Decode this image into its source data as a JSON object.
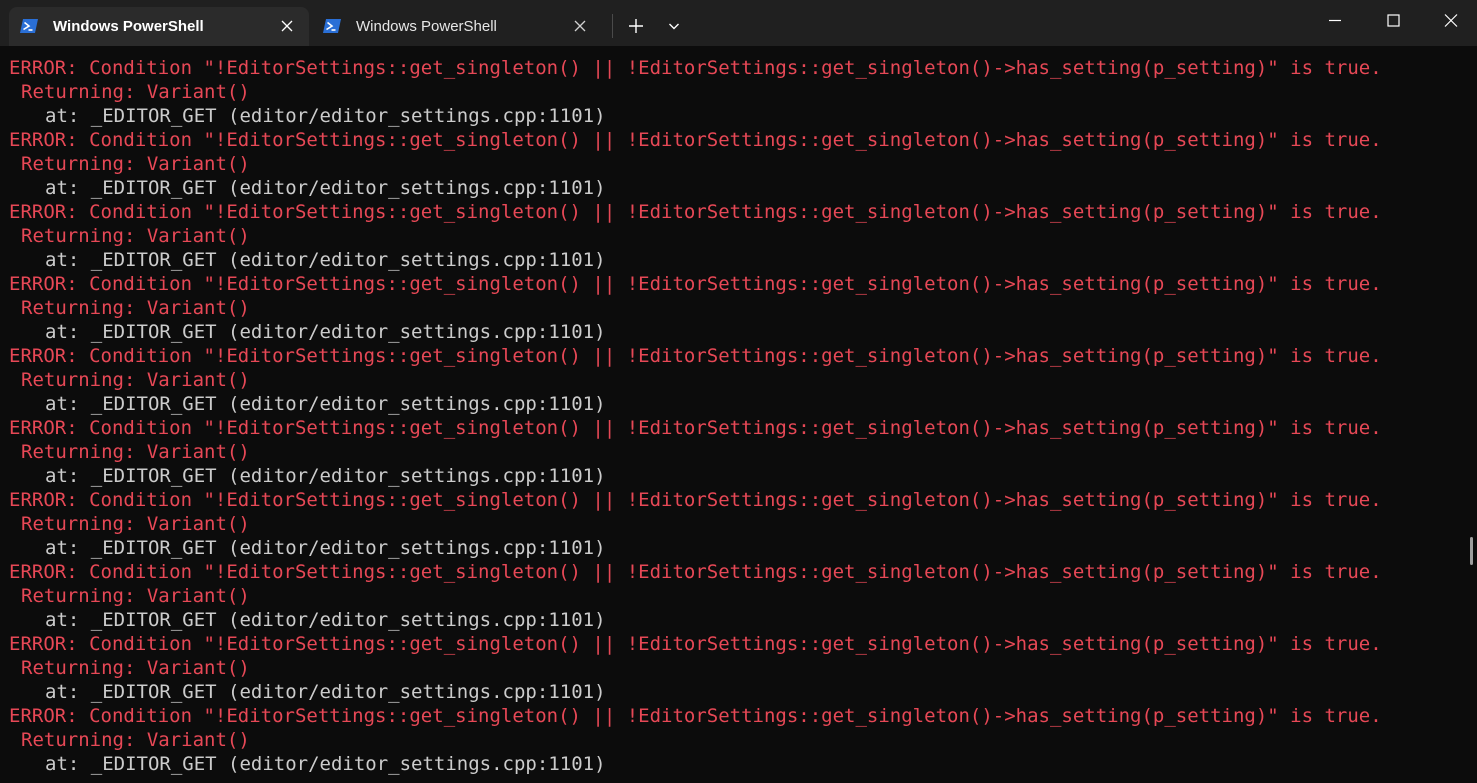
{
  "tabs": [
    {
      "title": "Windows PowerShell",
      "active": true,
      "icon": "powershell-icon"
    },
    {
      "title": "Windows PowerShell",
      "active": false,
      "icon": "powershell-icon"
    }
  ],
  "colors": {
    "background": "#0c0c0c",
    "titlebar": "#202020",
    "active_tab": "#2b2b2b",
    "error_red": "#e74856",
    "normal_text": "#cccccc",
    "ps_icon_blue": "#2a6fd6"
  },
  "terminal": {
    "entries": [
      {
        "prefix": "ERROR:",
        "message": " Condition \"!EditorSettings::get_singleton() || !EditorSettings::get_singleton()->has_setting(p_setting)\" is true.",
        "returning": "Returning: Variant()",
        "at": "at: _EDITOR_GET (editor/editor_settings.cpp:1101)"
      },
      {
        "prefix": "ERROR:",
        "message": " Condition \"!EditorSettings::get_singleton() || !EditorSettings::get_singleton()->has_setting(p_setting)\" is true.",
        "returning": "Returning: Variant()",
        "at": "at: _EDITOR_GET (editor/editor_settings.cpp:1101)"
      },
      {
        "prefix": "ERROR:",
        "message": " Condition \"!EditorSettings::get_singleton() || !EditorSettings::get_singleton()->has_setting(p_setting)\" is true.",
        "returning": "Returning: Variant()",
        "at": "at: _EDITOR_GET (editor/editor_settings.cpp:1101)"
      },
      {
        "prefix": "ERROR:",
        "message": " Condition \"!EditorSettings::get_singleton() || !EditorSettings::get_singleton()->has_setting(p_setting)\" is true.",
        "returning": "Returning: Variant()",
        "at": "at: _EDITOR_GET (editor/editor_settings.cpp:1101)"
      },
      {
        "prefix": "ERROR:",
        "message": " Condition \"!EditorSettings::get_singleton() || !EditorSettings::get_singleton()->has_setting(p_setting)\" is true.",
        "returning": "Returning: Variant()",
        "at": "at: _EDITOR_GET (editor/editor_settings.cpp:1101)"
      },
      {
        "prefix": "ERROR:",
        "message": " Condition \"!EditorSettings::get_singleton() || !EditorSettings::get_singleton()->has_setting(p_setting)\" is true.",
        "returning": "Returning: Variant()",
        "at": "at: _EDITOR_GET (editor/editor_settings.cpp:1101)"
      },
      {
        "prefix": "ERROR:",
        "message": " Condition \"!EditorSettings::get_singleton() || !EditorSettings::get_singleton()->has_setting(p_setting)\" is true.",
        "returning": "Returning: Variant()",
        "at": "at: _EDITOR_GET (editor/editor_settings.cpp:1101)"
      },
      {
        "prefix": "ERROR:",
        "message": " Condition \"!EditorSettings::get_singleton() || !EditorSettings::get_singleton()->has_setting(p_setting)\" is true.",
        "returning": "Returning: Variant()",
        "at": "at: _EDITOR_GET (editor/editor_settings.cpp:1101)"
      },
      {
        "prefix": "ERROR:",
        "message": " Condition \"!EditorSettings::get_singleton() || !EditorSettings::get_singleton()->has_setting(p_setting)\" is true.",
        "returning": "Returning: Variant()",
        "at": "at: _EDITOR_GET (editor/editor_settings.cpp:1101)"
      },
      {
        "prefix": "ERROR:",
        "message": " Condition \"!EditorSettings::get_singleton() || !EditorSettings::get_singleton()->has_setting(p_setting)\" is true.",
        "returning": "Returning: Variant()",
        "at": "at: _EDITOR_GET (editor/editor_settings.cpp:1101)"
      }
    ]
  }
}
